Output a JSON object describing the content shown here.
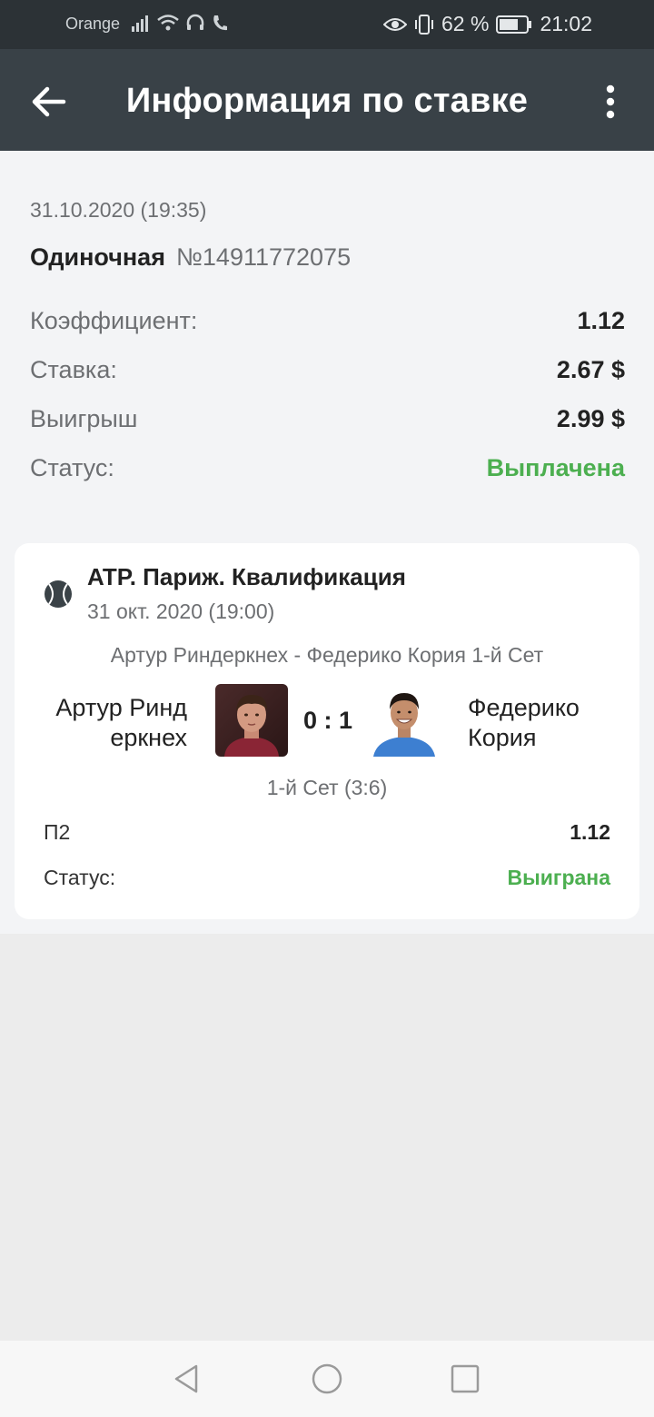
{
  "status_bar": {
    "carrier": "Orange",
    "battery": "62 %",
    "time": "21:02"
  },
  "header": {
    "title": "Информация по ставке",
    "back_icon": "arrow-left-icon",
    "menu_icon": "more-vertical-icon"
  },
  "bet": {
    "date": "31.10.2020 (19:35)",
    "type": "Одиночная",
    "number": "№14911772075",
    "coef_label": "Коэффициент:",
    "coef_value": "1.12",
    "stake_label": "Ставка:",
    "stake_value": "2.67 $",
    "win_label": "Выигрыш",
    "win_value": "2.99 $",
    "status_label": "Статус:",
    "status_value": "Выплачена"
  },
  "event": {
    "sport_icon": "tennis-ball-icon",
    "league": "ATP. Париж. Квалификация",
    "date": "31 окт. 2020 (19:00)",
    "match": "Артур Риндеркнех - Федерико Кория 1-й Сет",
    "team1_line1": "Артур Ринд",
    "team1_line2": "еркнех",
    "team2_line1": "Федерико",
    "team2_line2": "Кория",
    "score": "0 : 1",
    "set_info": "1-й Сет (3:6)",
    "outcome_label": "П2",
    "outcome_value": "1.12",
    "status_label": "Статус:",
    "status_value": "Выиграна"
  },
  "colors": {
    "status_bar": "#2c3236",
    "app_bar": "#394147",
    "success": "#4caf50",
    "background": "#f3f4f6"
  }
}
